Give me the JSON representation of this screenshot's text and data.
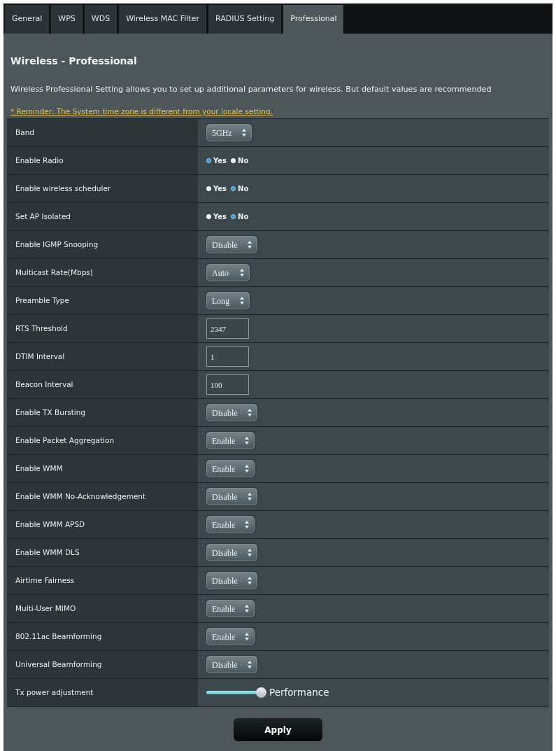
{
  "tabs": [
    {
      "label": "General",
      "selected": false
    },
    {
      "label": "WPS",
      "selected": false
    },
    {
      "label": "WDS",
      "selected": false
    },
    {
      "label": "Wireless MAC Filter",
      "selected": false
    },
    {
      "label": "RADIUS Setting",
      "selected": false
    },
    {
      "label": "Professional",
      "selected": true
    }
  ],
  "title": "Wireless - Professional",
  "description": "Wireless Professional Setting allows you to set up additional parameters for wireless. But default values are recommended",
  "reminder": "* Reminder: The System time zone is different from your locale setting.",
  "settings": [
    {
      "label": "Band",
      "kind": "select",
      "value": "5GHz"
    },
    {
      "label": "Enable Radio",
      "kind": "radio",
      "options": [
        {
          "label": "Yes",
          "selected": true
        },
        {
          "label": "No",
          "selected": false
        }
      ]
    },
    {
      "label": "Enable wireless scheduler",
      "kind": "radio",
      "options": [
        {
          "label": "Yes",
          "selected": false
        },
        {
          "label": "No",
          "selected": true
        }
      ]
    },
    {
      "label": "Set AP Isolated",
      "kind": "radio",
      "options": [
        {
          "label": "Yes",
          "selected": false
        },
        {
          "label": "No",
          "selected": true
        }
      ]
    },
    {
      "label": "Enable IGMP Snooping",
      "kind": "select",
      "value": "Disable"
    },
    {
      "label": "Multicast Rate(Mbps)",
      "kind": "select",
      "value": "Auto"
    },
    {
      "label": "Preamble Type",
      "kind": "select",
      "value": "Long"
    },
    {
      "label": "RTS Threshold",
      "kind": "input",
      "value": "2347"
    },
    {
      "label": "DTIM Interval",
      "kind": "input",
      "value": "1"
    },
    {
      "label": "Beacon Interval",
      "kind": "input",
      "value": "100"
    },
    {
      "label": "Enable TX Bursting",
      "kind": "select",
      "value": "Disable"
    },
    {
      "label": "Enable Packet Aggregation",
      "kind": "select",
      "value": "Enable"
    },
    {
      "label": "Enable WMM",
      "kind": "select",
      "value": "Enable"
    },
    {
      "label": "Enable WMM No-Acknowledgement",
      "kind": "select",
      "value": "Disable"
    },
    {
      "label": "Enable WMM APSD",
      "kind": "select",
      "value": "Enable"
    },
    {
      "label": "Enable WMM DLS",
      "kind": "select",
      "value": "Disable"
    },
    {
      "label": "Airtime Fairness",
      "kind": "select",
      "value": "Disable"
    },
    {
      "label": "Multi-User MIMO",
      "kind": "select",
      "value": "Enable"
    },
    {
      "label": "802.11ac Beamforming",
      "kind": "select",
      "value": "Enable"
    },
    {
      "label": "Universal Beamforming",
      "kind": "select",
      "value": "Disable"
    },
    {
      "label": "Tx power adjustment",
      "kind": "slider",
      "level": 1,
      "reading": "Performance"
    }
  ],
  "apply_button": "Apply"
}
